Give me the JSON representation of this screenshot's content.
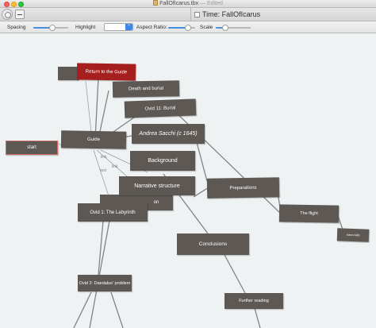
{
  "window": {
    "title": "FallOfIcarus.tbx",
    "status": "— Edited"
  },
  "toolbar": {
    "time_title": "Time: FallOfIcarus"
  },
  "controls": {
    "spacing_label": "Spacing",
    "highlight_label": "Highlight",
    "aspect_ratio_label": "Aspect Ratio:",
    "scale_label": "Scale",
    "spacing_value": 0.55,
    "aspect_ratio_value": 0.75,
    "scale_value": 0.2
  },
  "colors": {
    "note": "#5d5854",
    "note_selected": "#a41f1d",
    "link": "#7e8486",
    "canvas": "#eef2f2"
  },
  "canvas": {
    "edge_labels": [
      "link",
      "link",
      "text"
    ],
    "notes": {
      "return_to_guide": "Return to the Guide",
      "death_and_burial": "Death and burial",
      "ovid_burial": "Ovid 11: Burial",
      "andrea_sacchi": "Andrea Sacchi (c 1645)",
      "start": "start",
      "guide": "Guide",
      "background": "Background",
      "narrative_structure": "Narrative structure",
      "preparations": "Preparations",
      "partial_on": "on",
      "ovid_labyrinth": "Ovid 1: The Labyrinth",
      "the_flight": "The flight",
      "icarus_falls": "Icarus falls",
      "conclusions": "Conclusions",
      "ovid_daedalus": "Ovid 2: Daedalus' problem",
      "further_reading": "Further reading"
    }
  }
}
